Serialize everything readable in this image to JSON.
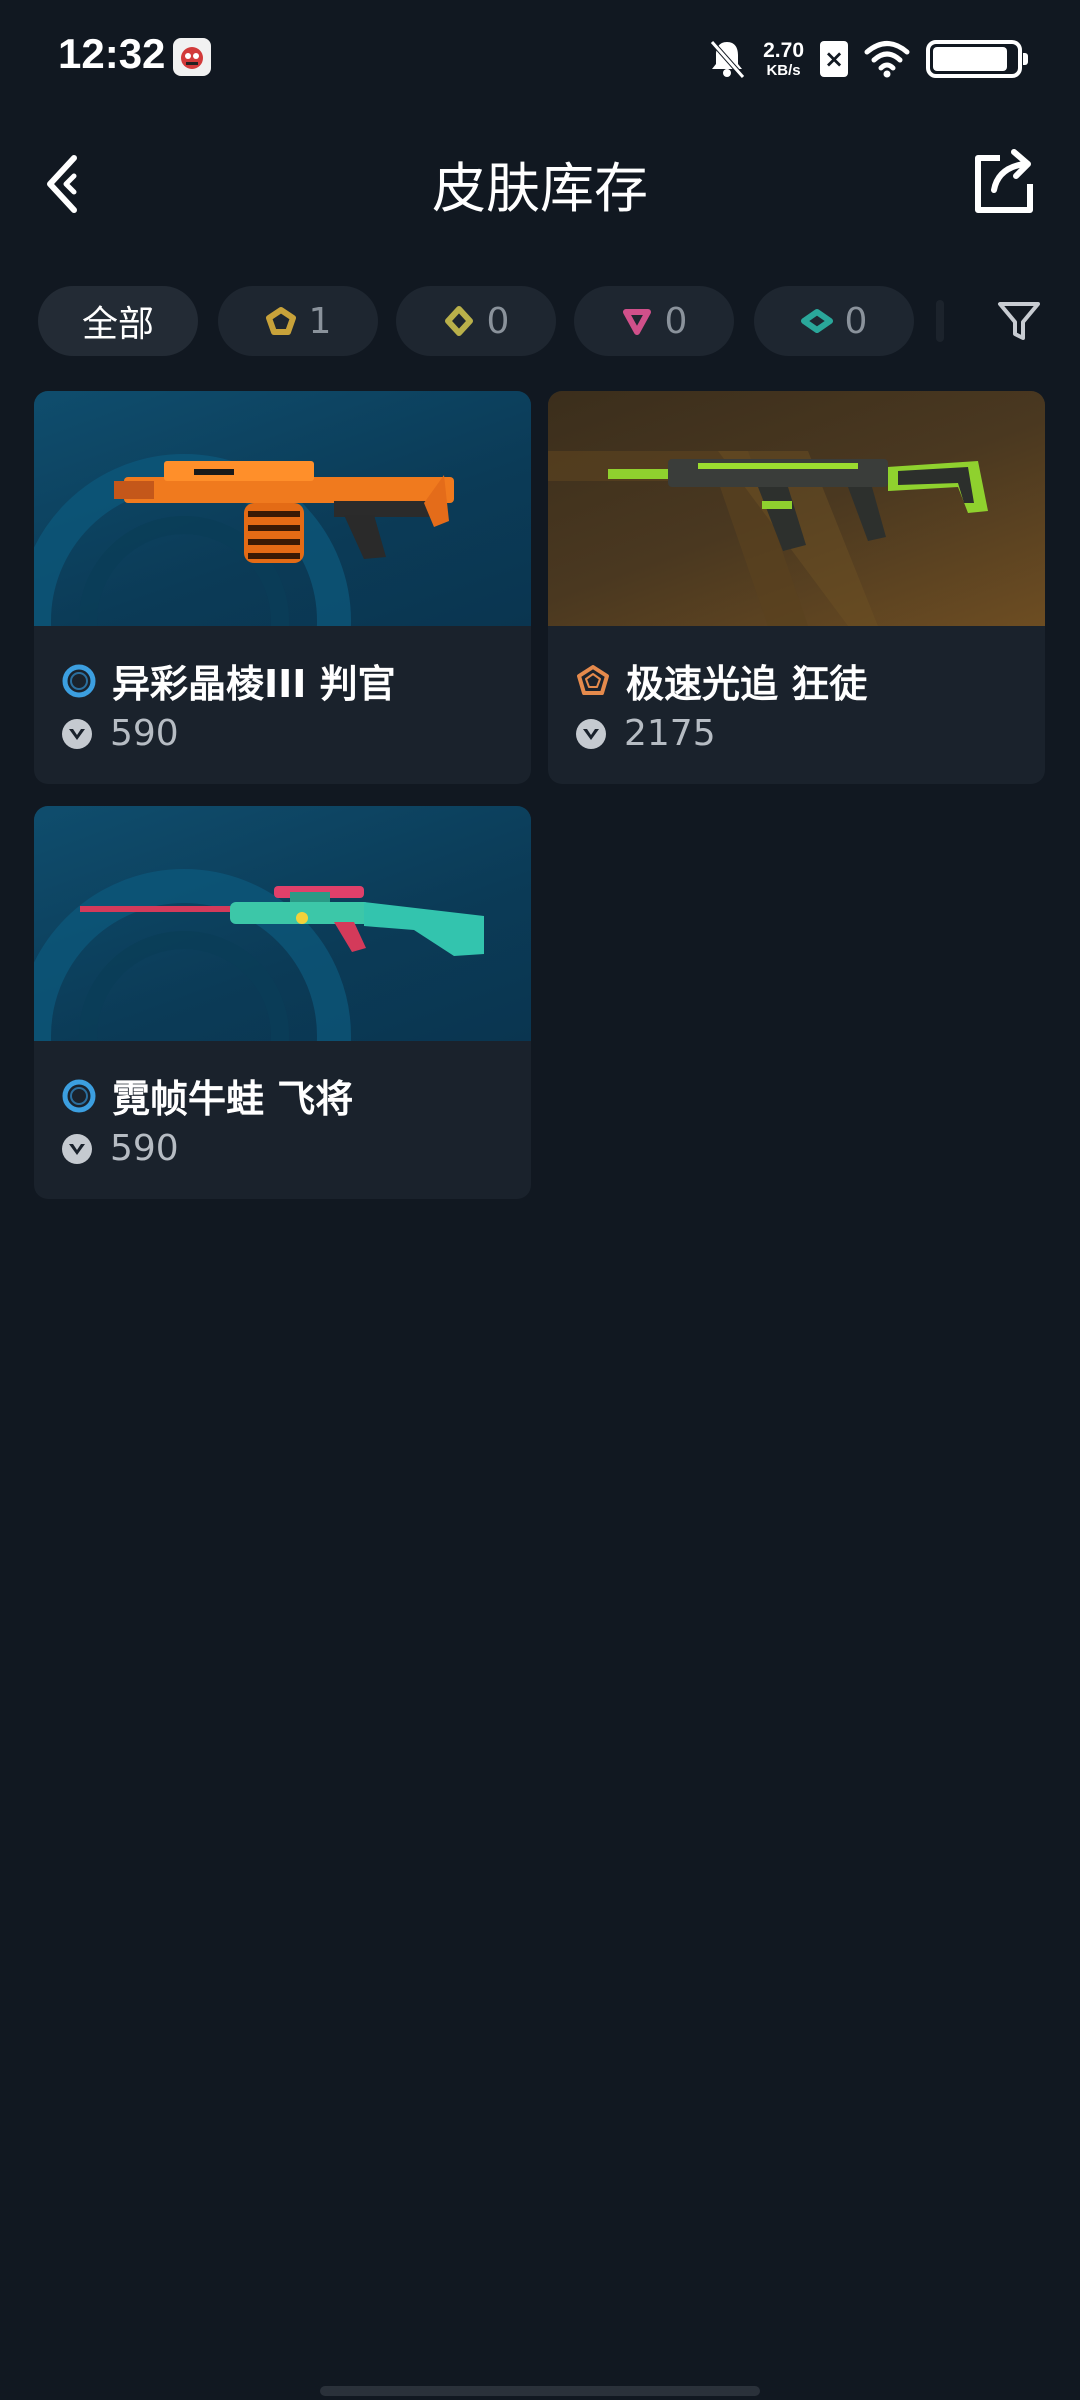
{
  "status_bar": {
    "time": "12:32",
    "net_speed_value": "2.70",
    "net_speed_unit": "KB/s",
    "sim_label": "×",
    "battery_level": 0.9
  },
  "header": {
    "title": "皮肤库存"
  },
  "filters": [
    {
      "label": "全部",
      "active": true,
      "icon": ""
    },
    {
      "label": "1",
      "active": false,
      "icon": "pentagon-gold-tier-icon",
      "color": "#c8a23a"
    },
    {
      "label": "0",
      "active": false,
      "icon": "diamond-yellow-tier-icon",
      "color": "#b9b04a"
    },
    {
      "label": "0",
      "active": false,
      "icon": "triangle-pink-tier-icon",
      "color": "#d0508a"
    },
    {
      "label": "0",
      "active": false,
      "icon": "rhombus-teal-tier-icon",
      "color": "#2aa79a"
    }
  ],
  "skins": [
    {
      "name": "异彩晶棱III 判官",
      "price": "590",
      "tier_icon": "blue-ring-tier-icon",
      "tier_color": "#3c9fe0",
      "bg": "blue"
    },
    {
      "name": "极速光追 狂徒",
      "price": "2175",
      "tier_icon": "orange-pentagon-tier-icon",
      "tier_color": "#e58a4c",
      "bg": "gold"
    },
    {
      "name": "霓帧牛蛙 飞将",
      "price": "590",
      "tier_icon": "blue-ring-tier-icon",
      "tier_color": "#3c9fe0",
      "bg": "blue"
    }
  ]
}
